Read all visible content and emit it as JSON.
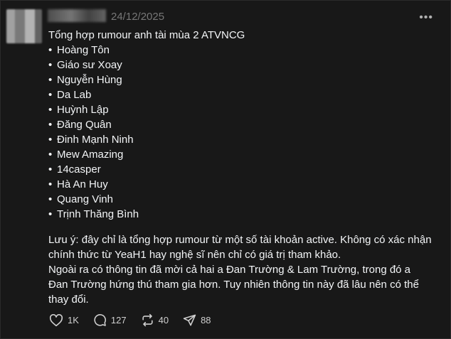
{
  "post": {
    "timestamp": "24/12/2025",
    "headline": "Tổng hợp rumour anh tài mùa 2 ATVNCG",
    "bullet_char": "•",
    "items": [
      "Hoàng Tôn",
      "Giáo sư Xoay",
      "Nguyễn Hùng",
      "Da Lab",
      "Huỳnh Lập",
      "Đăng Quân",
      "Đinh Mạnh Ninh",
      "Mew Amazing",
      "14casper",
      "Hà An Huy",
      "Quang Vinh",
      "Trịnh Thăng Bình"
    ],
    "note_lines": [
      "Lưu ý: đây chỉ là tổng hợp rumour từ một số tài khoản active. Không có xác nhận",
      "chính thức từ YeaH1 hay nghệ sĩ nên chỉ có giá trị tham khảo.",
      "Ngoài ra có thông tin đã mời cả hai a Đan Trường & Lam Trường, trong đó a",
      "Đan Trường hứng thú tham gia hơn. Tuy nhiên thông tin này đã lâu nên có thể",
      "thay đổi."
    ]
  },
  "actions": {
    "likes": "1K",
    "comments": "127",
    "reposts": "40",
    "shares": "88"
  },
  "icons": {
    "more": "more-options-icon",
    "like": "heart-icon",
    "comment": "comment-icon",
    "repost": "repost-icon",
    "share": "send-icon"
  },
  "colors": {
    "background": "#181818",
    "text": "#f3f5f7",
    "muted": "#777777"
  }
}
